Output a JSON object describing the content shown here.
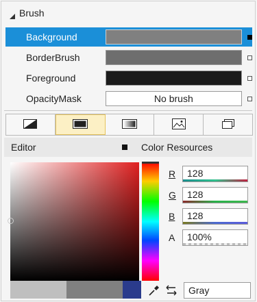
{
  "brush": {
    "title": "Brush",
    "rows": [
      {
        "label": "Background",
        "value": "",
        "color": "#808080",
        "selected": true
      },
      {
        "label": "BorderBrush",
        "value": "",
        "color": "#6e6e6e",
        "selected": false
      },
      {
        "label": "Foreground",
        "value": "",
        "color": "#1b1b1b",
        "selected": false
      },
      {
        "label": "OpacityMask",
        "value": "No brush",
        "color": "#ffffff",
        "selected": false
      }
    ]
  },
  "brush_tabs": [
    {
      "icon": "no-brush-icon"
    },
    {
      "icon": "solid-brush-icon",
      "active": true
    },
    {
      "icon": "gradient-brush-icon"
    },
    {
      "icon": "image-brush-icon"
    },
    {
      "icon": "resource-brush-icon"
    }
  ],
  "editor": {
    "title": "Editor",
    "resources": "Color Resources"
  },
  "channels": [
    {
      "key": "R",
      "value": "128",
      "bar": "#2ec08b"
    },
    {
      "key": "G",
      "value": "128",
      "bar": "#28b24a"
    },
    {
      "key": "B",
      "value": "128",
      "bar": "#4b6ad0"
    },
    {
      "key": "A",
      "value": "100%",
      "bar": "#cccccc"
    }
  ],
  "color_name": "Gray",
  "colors": {
    "selection": "#1b8fd8",
    "current": "#808080",
    "new": "#2a3b8c"
  }
}
